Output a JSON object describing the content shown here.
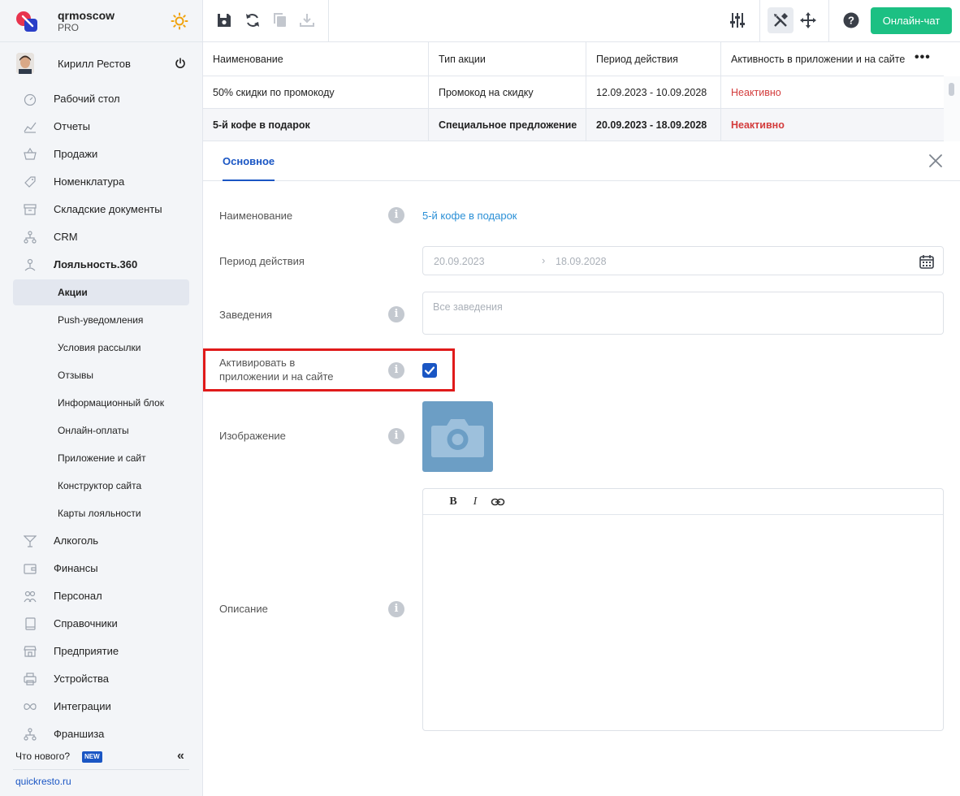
{
  "brand": {
    "name": "qrmoscow",
    "plan": "PRO"
  },
  "user": {
    "name": "Кирилл Рестов"
  },
  "nav": {
    "items": [
      {
        "label": "Рабочий стол",
        "icon": "dashboard-icon"
      },
      {
        "label": "Отчеты",
        "icon": "reports-icon"
      },
      {
        "label": "Продажи",
        "icon": "basket-icon"
      },
      {
        "label": "Номенклатура",
        "icon": "tag-icon"
      },
      {
        "label": "Складские документы",
        "icon": "archive-icon"
      },
      {
        "label": "CRM",
        "icon": "crm-icon"
      },
      {
        "label": "Лояльность.360",
        "icon": "loyalty-icon"
      }
    ],
    "loyalty_sub": [
      {
        "label": "Акции",
        "active": true
      },
      {
        "label": "Push-уведомления"
      },
      {
        "label": "Условия рассылки"
      },
      {
        "label": "Отзывы"
      },
      {
        "label": "Информационный блок"
      },
      {
        "label": "Онлайн-оплаты"
      },
      {
        "label": "Приложение и сайт"
      },
      {
        "label": "Конструктор сайта"
      },
      {
        "label": "Карты лояльности"
      }
    ],
    "items_after": [
      {
        "label": "Алкоголь",
        "icon": "cocktail-icon"
      },
      {
        "label": "Финансы",
        "icon": "wallet-icon"
      },
      {
        "label": "Персонал",
        "icon": "staff-icon"
      },
      {
        "label": "Справочники",
        "icon": "book-icon"
      },
      {
        "label": "Предприятие",
        "icon": "store-icon"
      },
      {
        "label": "Устройства",
        "icon": "printer-icon"
      },
      {
        "label": "Интеграции",
        "icon": "infinity-icon"
      },
      {
        "label": "Франшиза",
        "icon": "franchise-icon"
      }
    ]
  },
  "sidebar_footer": {
    "whats_new": "Что нового?",
    "new_badge": "NEW",
    "link": "quickresto.ru"
  },
  "toolbar": {
    "icons": [
      "save-icon",
      "refresh-icon",
      "copy-icon",
      "download-icon",
      "filter-sliders-icon",
      "tools-icon",
      "move-icon",
      "help-icon"
    ],
    "chat_label": "Онлайн-чат",
    "accent": "#1cc083"
  },
  "table": {
    "columns": [
      "Наименование",
      "Тип акции",
      "Период действия",
      "Активность в приложении и на сайте"
    ],
    "rows": [
      {
        "name": "50% скидки по промокоду",
        "type": "Промокод на скидку",
        "period": "12.09.2023 - 10.09.2028",
        "status": "Неактивно",
        "selected": false
      },
      {
        "name": "5-й кофе в подарок",
        "type": "Специальное предложение",
        "period": "20.09.2023 - 18.09.2028",
        "status": "Неактивно",
        "selected": true
      }
    ],
    "status_color": "#d33c3c"
  },
  "panel": {
    "tab": "Основное",
    "fields": {
      "name_label": "Наименование",
      "name_value": "5-й кофе в подарок",
      "period_label": "Период действия",
      "period_from": "20.09.2023",
      "period_to": "18.09.2028",
      "venues_label": "Заведения",
      "venues_placeholder": "Все заведения",
      "activate_label": "Активировать в приложении и на сайте",
      "activate_checked": true,
      "image_label": "Изображение",
      "description_label": "Описание"
    },
    "editor_buttons": [
      "bold-icon",
      "italic-icon",
      "link-icon"
    ],
    "accent": "#1a56c4",
    "highlight_color": "#e01a1a"
  }
}
